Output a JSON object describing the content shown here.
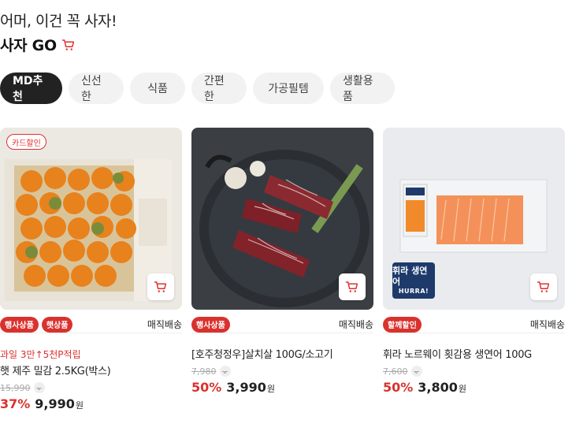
{
  "header": {
    "line1": "어머, 이건 꼭 사자!",
    "line2": "사자 GO",
    "cart_icon": "cart-icon"
  },
  "tabs": [
    {
      "label": "MD추천",
      "active": true
    },
    {
      "label": "신선한",
      "active": false
    },
    {
      "label": "식품",
      "active": false
    },
    {
      "label": "간편한",
      "active": false
    },
    {
      "label": "가공필템",
      "active": false
    },
    {
      "label": "생활용품",
      "active": false
    }
  ],
  "products": [
    {
      "image": "tangerines-box",
      "badge": "카드할인",
      "tags": [
        "행사상품",
        "햇상품"
      ],
      "delivery": "매직배송",
      "promo": "과일 3만↑5천P적립",
      "name": "햇 제주 밀감 2.5KG(박스)",
      "original_price": "15,990",
      "discount": "37%",
      "price": "9,990",
      "currency": "원"
    },
    {
      "image": "beef-plate",
      "badge": "",
      "tags": [
        "행사상품"
      ],
      "delivery": "매직배송",
      "promo": "",
      "name": "[호주청정우]살치살 100G/소고기",
      "original_price": "7,980",
      "discount": "50%",
      "price": "3,990",
      "currency": "원"
    },
    {
      "image": "salmon-pack",
      "badge": "",
      "overlay_title": "휘라 생연어",
      "overlay_sub": "HURRA!",
      "tags": [
        "할께할인"
      ],
      "delivery": "매직배송",
      "promo": "",
      "name": "휘라 노르웨이 횟감용 생연어 100G",
      "original_price": "7,600",
      "discount": "50%",
      "price": "3,800",
      "currency": "원"
    }
  ],
  "colors": {
    "accent": "#d9322e",
    "tab_active_bg": "#222222",
    "tab_bg": "#f2f2f2"
  }
}
